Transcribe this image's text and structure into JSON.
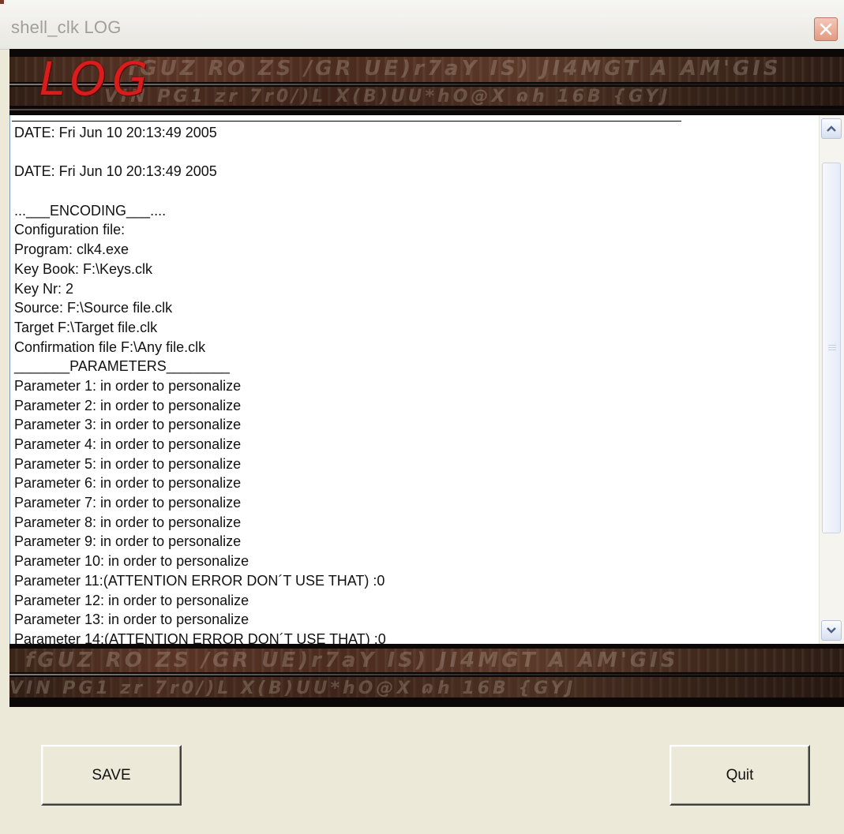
{
  "window": {
    "title": "shell_clk LOG",
    "close_icon": "close-x-icon"
  },
  "banner": {
    "logo_text": "LOG",
    "texture_glyphs_top": "fGUZ RO ZS /GR UE)r7aY IS) JI4MGT A AM'GIS",
    "texture_glyphs_bottom": "VIN PG1 zr 7r0/)L X(B)UU*hO@X ɷh 16B {GYJ",
    "colors": {
      "logo_red": "#d81d1d",
      "background": "#0b0807"
    }
  },
  "log": {
    "lines": [
      "DATE: Fri Jun 10 20:13:49 2005",
      "",
      "DATE: Fri Jun 10 20:13:49 2005",
      "",
      "...___ENCODING___....",
      "Configuration file:",
      "Program: clk4.exe",
      "Key Book: F:\\Keys.clk",
      "Key Nr: 2",
      "Source: F:\\Source file.clk",
      "Target F:\\Target file.clk",
      "Confirmation file F:\\Any file.clk",
      "_______PARAMETERS________",
      "Parameter 1: in order to personalize",
      "Parameter 2: in order to personalize",
      "Parameter 3: in order to personalize",
      "Parameter 4: in order to personalize",
      "Parameter 5: in order to personalize",
      "Parameter 6: in order to personalize",
      "Parameter 7: in order to personalize",
      "Parameter 8: in order to personalize",
      "Parameter 9: in order to personalize",
      "Parameter 10: in order to personalize",
      "Parameter 11:(ATTENTION ERROR DON´T USE THAT) :0",
      "Parameter 12: in order to personalize",
      "Parameter 13: in order to personalize",
      "Parameter 14:(ATTENTION ERROR DON´T USE THAT) :0"
    ]
  },
  "scrollbar": {
    "up_icon": "chevron-up-icon",
    "down_icon": "chevron-down-icon",
    "grip_icon": "grip-lines-icon"
  },
  "buttons": {
    "save_label": "SAVE",
    "quit_label": "Quit"
  }
}
